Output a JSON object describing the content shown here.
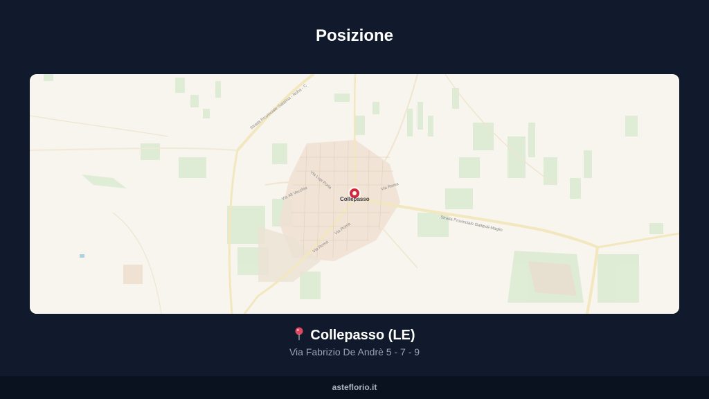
{
  "page": {
    "title": "Posizione"
  },
  "map": {
    "place_label": "Collepasso",
    "street_labels": {
      "sp_galatina": "Strada Provinciale Galatina - Noha - C",
      "sp_gallipoli": "Strada Provinciale Gallipoli-Maglie",
      "via_alt_vecchia": "Via Alt Vecchia",
      "via_lupi": "Via Lupi Porta",
      "via_roma_ne": "Via Roma",
      "via_roma_sw1": "Via Roma",
      "via_roma_sw2": "Via Roma"
    },
    "marker_color": "#d32637"
  },
  "location": {
    "pin_icon": "pushpin-icon",
    "name": "Collepasso (LE)",
    "address": "Via Fabrizio De Andrè 5 - 7 - 9"
  },
  "footer": {
    "text": "asteflorio.it"
  }
}
